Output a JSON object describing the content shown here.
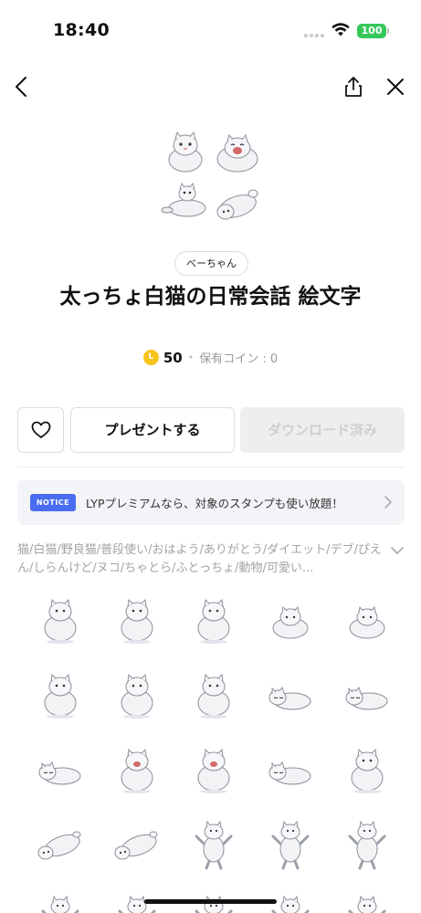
{
  "status_bar": {
    "time": "18:40",
    "battery": "100"
  },
  "product": {
    "author": "べーちゃん",
    "title": "太っちょ白猫の日常会話 絵文字",
    "price": "50",
    "owned_coins": "保有コイン : 0",
    "coin_symbol": "L",
    "separator": "•"
  },
  "actions": {
    "present_label": "プレゼントする",
    "download_label": "ダウンロード済み"
  },
  "notice": {
    "badge": "NOTICE",
    "text": "LYPプレミアムなら、対象のスタンプも使い放題！"
  },
  "tags": "猫/白猫/野良猫/普段使い/おはよう/ありがとう/ダイエット/デブ/ぴえん/しらんけど/ヌコ/ちゃとら/ふとっちょ/動物/可愛い...",
  "colors": {
    "accent_blue": "#4a6cf0",
    "coin_yellow": "#f7c41c",
    "battery_green": "#35c759"
  },
  "icons": [
    "back-icon",
    "share-icon",
    "close-icon",
    "heart-icon",
    "chevron-right-icon",
    "chevron-down-icon",
    "wifi-icon"
  ],
  "stickers": [
    {
      "pose": "sit-front"
    },
    {
      "pose": "sit-side"
    },
    {
      "pose": "sit-front"
    },
    {
      "pose": "loaf"
    },
    {
      "pose": "loaf"
    },
    {
      "pose": "sit-front"
    },
    {
      "pose": "sit-front"
    },
    {
      "pose": "sit-front"
    },
    {
      "pose": "sleep"
    },
    {
      "pose": "lie"
    },
    {
      "pose": "lie"
    },
    {
      "pose": "sit-open"
    },
    {
      "pose": "sit-open"
    },
    {
      "pose": "lie"
    },
    {
      "pose": "sit-front"
    },
    {
      "pose": "lie-back"
    },
    {
      "pose": "lie-back"
    },
    {
      "pose": "dance"
    },
    {
      "pose": "dance"
    },
    {
      "pose": "dance"
    },
    {
      "pose": "dance"
    },
    {
      "pose": "dance"
    },
    {
      "pose": "dance"
    },
    {
      "pose": "dance"
    },
    {
      "pose": "dance"
    }
  ]
}
